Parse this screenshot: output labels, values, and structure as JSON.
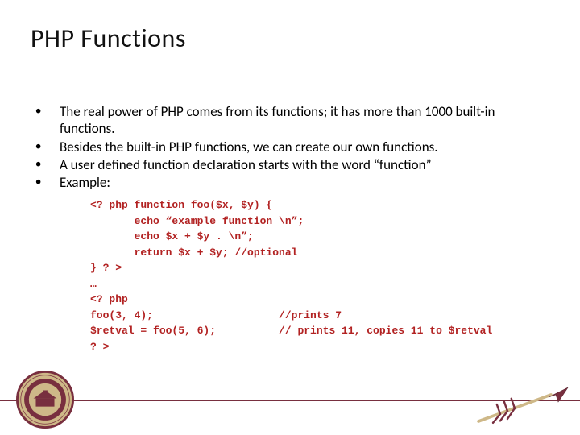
{
  "title": "PHP Functions",
  "bullets": [
    "The real power of PHP comes from its functions; it has more than 1000 built-in functions.",
    "Besides the built-in PHP functions, we can create our own functions.",
    "A user defined function declaration starts with the word “function”",
    "Example:"
  ],
  "code": "<? php function foo($x, $y) {\n       echo “example function \\n”;\n       echo $x + $y . \\n”;\n       return $x + $y; //optional\n} ? >\n…\n<? php\nfoo(3, 4);                    //prints 7\n$retval = foo(5, 6);          // prints 11, copies 11 to $retval\n? >",
  "footer": {
    "seal_label": "Florida State University Seal",
    "spear_label": "FSU Spear"
  }
}
